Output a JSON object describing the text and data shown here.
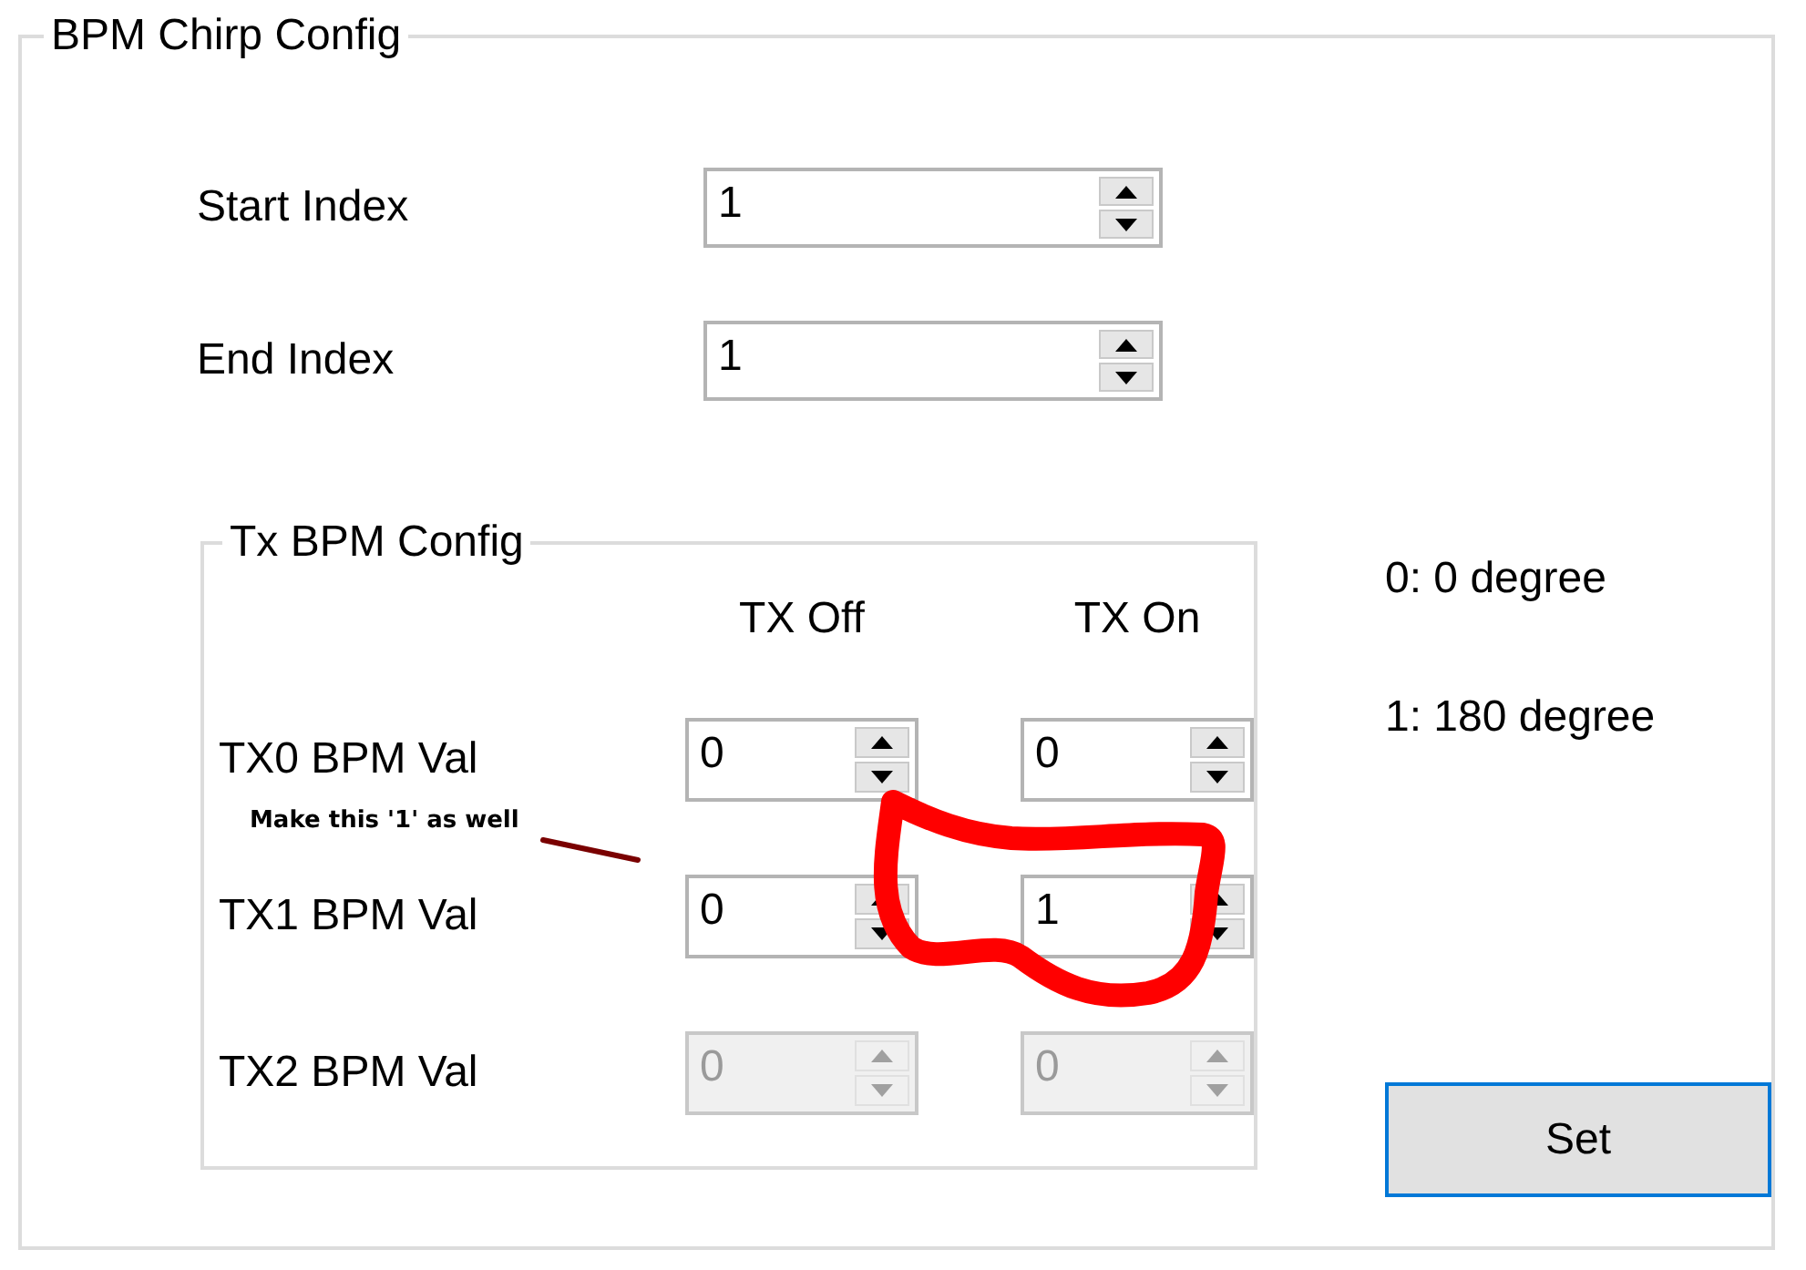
{
  "group": {
    "title": "BPM Chirp Config"
  },
  "index_fields": [
    {
      "label": "Start Index",
      "value": "1"
    },
    {
      "label": "End Index",
      "value": "1"
    }
  ],
  "tx_bpm_config": {
    "title": "Tx BPM Config",
    "columns": [
      "TX Off",
      "TX On"
    ],
    "rows": [
      {
        "label": "TX0 BPM Val",
        "values": [
          "0",
          "0"
        ],
        "disabled": false
      },
      {
        "label": "TX1 BPM Val",
        "values": [
          "0",
          "1"
        ],
        "disabled": false
      },
      {
        "label": "TX2 BPM Val",
        "values": [
          "0",
          "0"
        ],
        "disabled": true
      }
    ]
  },
  "legend_notes": [
    "0: 0 degree",
    "1: 180 degree"
  ],
  "set_button": "Set",
  "annotation": {
    "note": "Make this '1' as well"
  }
}
